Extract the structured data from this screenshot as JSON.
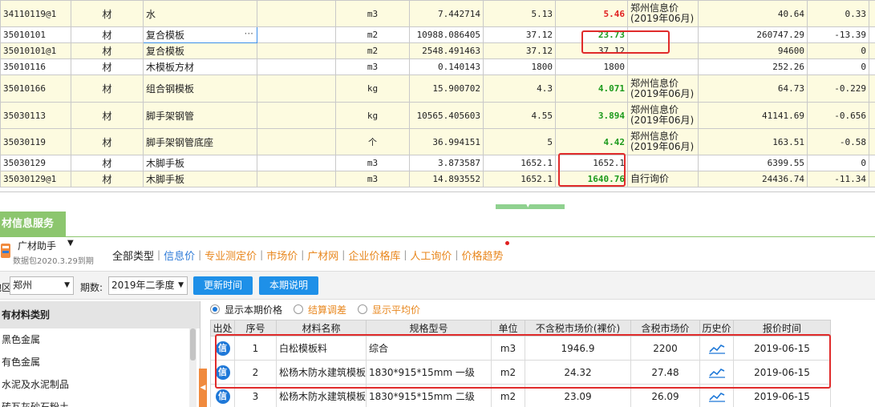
{
  "top_grid": {
    "rows": [
      {
        "code": "34110119@1",
        "type": "材",
        "name": "水",
        "spec": "",
        "unit": "m3",
        "qty": "7.442714",
        "price1": "5.13",
        "price2": "5.46",
        "price2_style": "red",
        "source": "郑州信息价(2019年06月)",
        "amount": "40.64",
        "diff": "0.33",
        "band": "yellow"
      },
      {
        "code": "35010101",
        "type": "材",
        "name": "复合模板",
        "spec": "",
        "unit": "m2",
        "qty": "10988.086405",
        "price1": "37.12",
        "price2": "23.73",
        "price2_style": "green",
        "source": "",
        "amount": "260747.29",
        "diff": "-13.39",
        "band": "white",
        "selected": true
      },
      {
        "code": "35010101@1",
        "type": "材",
        "name": "复合模板",
        "spec": "",
        "unit": "m2",
        "qty": "2548.491463",
        "price1": "37.12",
        "price2": "37.12",
        "price2_style": "plain",
        "source": "",
        "amount": "94600",
        "diff": "0",
        "band": "yellow"
      },
      {
        "code": "35010116",
        "type": "材",
        "name": "木模板方材",
        "spec": "",
        "unit": "m3",
        "qty": "0.140143",
        "price1": "1800",
        "price2": "1800",
        "price2_style": "plain",
        "source": "",
        "amount": "252.26",
        "diff": "0",
        "band": "white"
      },
      {
        "code": "35010166",
        "type": "材",
        "name": "组合钢模板",
        "spec": "",
        "unit": "kg",
        "qty": "15.900702",
        "price1": "4.3",
        "price2": "4.071",
        "price2_style": "green",
        "source": "郑州信息价(2019年06月)",
        "amount": "64.73",
        "diff": "-0.229",
        "band": "yellow"
      },
      {
        "code": "35030113",
        "type": "材",
        "name": "脚手架钢管",
        "spec": "",
        "unit": "kg",
        "qty": "10565.405603",
        "price1": "4.55",
        "price2": "3.894",
        "price2_style": "green",
        "source": "郑州信息价(2019年06月)",
        "amount": "41141.69",
        "diff": "-0.656",
        "band": "yellow"
      },
      {
        "code": "35030119",
        "type": "材",
        "name": "脚手架钢管底座",
        "spec": "",
        "unit": "个",
        "qty": "36.994151",
        "price1": "5",
        "price2": "4.42",
        "price2_style": "green",
        "source": "郑州信息价(2019年06月)",
        "amount": "163.51",
        "diff": "-0.58",
        "band": "yellow"
      },
      {
        "code": "35030129",
        "type": "材",
        "name": "木脚手板",
        "spec": "",
        "unit": "m3",
        "qty": "3.873587",
        "price1": "1652.1",
        "price2": "1652.1",
        "price2_style": "plain",
        "source": "",
        "amount": "6399.55",
        "diff": "0",
        "band": "white"
      },
      {
        "code": "35030129@1",
        "type": "材",
        "name": "木脚手板",
        "spec": "",
        "unit": "m3",
        "qty": "14.893552",
        "price1": "1652.1",
        "price2": "1640.76",
        "price2_style": "green",
        "source": "自行询价",
        "amount": "24436.74",
        "diff": "-11.34",
        "band": "yellow"
      }
    ]
  },
  "panel": {
    "tab_title": "材信息服务",
    "assistant_name": "广材助手",
    "assistant_sub": "数据包2020.3.29到期",
    "type_tabs": [
      "全部类型",
      "信息价",
      "专业测定价",
      "市场价",
      "广材网",
      "企业价格库",
      "人工询价",
      "价格趋势"
    ],
    "filter": {
      "region_label": "地区：",
      "region_value": "郑州",
      "period_label": "期数:",
      "period_value": "2019年二季度",
      "update_button": "更新时间",
      "desc_button": "本期说明"
    },
    "categories": {
      "header": "有材料类别",
      "items": [
        "黑色金属",
        "有色金属",
        "水泥及水泥制品",
        "砖瓦灰砂石粉土"
      ]
    },
    "price_options": [
      "显示本期价格",
      "结算调差",
      "显示平均价"
    ],
    "table": {
      "headers": [
        "出处",
        "序号",
        "材料名称",
        "规格型号",
        "单位",
        "不含税市场价(裸价)",
        "含税市场价",
        "历史价",
        "报价时间"
      ],
      "rows": [
        {
          "badge": "信",
          "no": "1",
          "name": "白松模板料",
          "spec": "综合",
          "unit": "m3",
          "price_ex": "1946.9",
          "price_in": "2200",
          "date": "2019-06-15"
        },
        {
          "badge": "信",
          "no": "2",
          "name": "松杨木防水建筑模板",
          "spec": "1830*915*15mm 一级",
          "unit": "m2",
          "price_ex": "24.32",
          "price_in": "27.48",
          "date": "2019-06-15"
        },
        {
          "badge": "信",
          "no": "3",
          "name": "松杨木防水建筑模板",
          "spec": "1830*915*15mm 二级",
          "unit": "m2",
          "price_ex": "23.09",
          "price_in": "26.09",
          "date": "2019-06-15"
        }
      ]
    }
  },
  "colors": {
    "accent_blue": "#1e90e8",
    "highlight_red": "#e02b2b",
    "panel_green": "#8cc66e",
    "price_green": "#1c9a1c",
    "price_red": "#e02020",
    "orange": "#e8871e"
  }
}
